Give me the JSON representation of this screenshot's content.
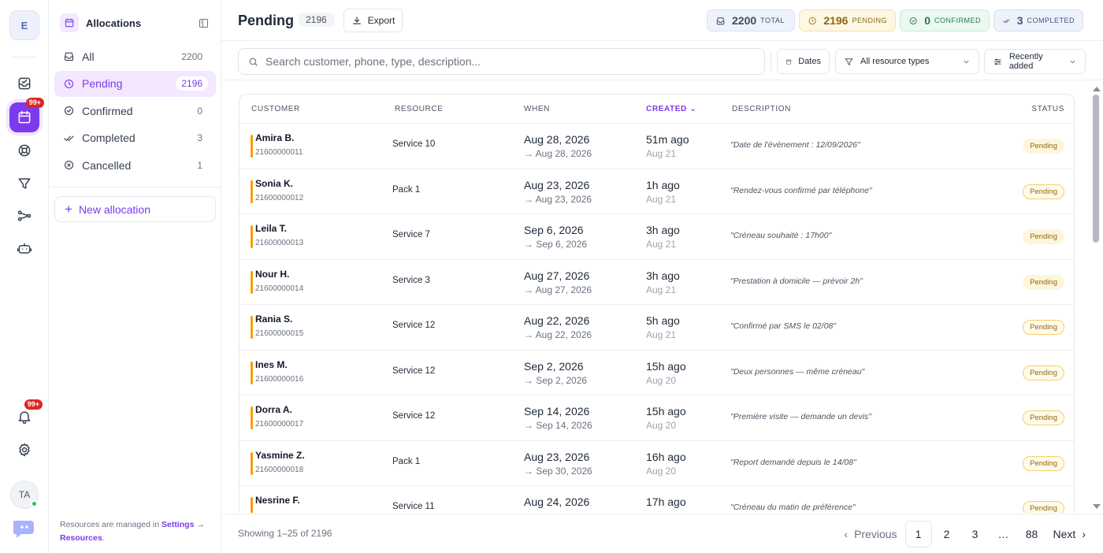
{
  "rail": {
    "workspace_initial": "E",
    "calendar_badge": "99+",
    "notifications_badge": "99+",
    "user_initials": "TA"
  },
  "sidebar": {
    "title": "Allocations",
    "items": [
      {
        "label": "All",
        "count": "2200",
        "icon": "inbox-icon"
      },
      {
        "label": "Pending",
        "count": "2196",
        "icon": "clock-icon"
      },
      {
        "label": "Confirmed",
        "count": "0",
        "icon": "check-circle-icon"
      },
      {
        "label": "Completed",
        "count": "3",
        "icon": "double-check-icon"
      },
      {
        "label": "Cancelled",
        "count": "1",
        "icon": "x-circle-icon"
      }
    ],
    "new_button": "New allocation",
    "footer_text": "Resources are managed in",
    "footer_link": "Settings → Resources",
    "footer_period": "."
  },
  "header": {
    "title": "Pending",
    "count": "2196",
    "export_label": "Export",
    "chips": {
      "total": {
        "value": "2200",
        "unit": "TOTAL"
      },
      "pending": {
        "value": "2196",
        "unit": "PENDING"
      },
      "confirmed": {
        "value": "0",
        "unit": "CONFIRMED"
      },
      "completed": {
        "value": "3",
        "unit": "COMPLETED"
      }
    }
  },
  "filters": {
    "search_placeholder": "Search customer, phone, type, description...",
    "dates_label": "Dates",
    "types_label": "All resource types",
    "sort_label": "Recently added"
  },
  "table": {
    "columns": {
      "customer": "CUSTOMER",
      "resource": "RESOURCE",
      "when": "WHEN",
      "created": "Created",
      "description": "DESCRIPTION",
      "status": "STATUS"
    },
    "rows": [
      {
        "name": "Amira B.",
        "phone": "21600000011",
        "resource": "Service 10",
        "when_start": "Aug 28, 2026",
        "when_end": "→ Aug 28, 2026",
        "created_rel": "51m ago",
        "created_date": "Aug 21",
        "description": "\"Date de l'évènement : 12/09/2026\"",
        "status": "Pending"
      },
      {
        "name": "Sonia K.",
        "phone": "21600000012",
        "resource": "Pack 1",
        "when_start": "Aug 23, 2026",
        "when_end": "→ Aug 23, 2026",
        "created_rel": "1h ago",
        "created_date": "Aug 21",
        "description": "\"Rendez-vous confirmé par téléphone\"",
        "status": "Pending"
      },
      {
        "name": "Leila T.",
        "phone": "21600000013",
        "resource": "Service 7",
        "when_start": "Sep 6, 2026",
        "when_end": "→ Sep 6, 2026",
        "created_rel": "3h ago",
        "created_date": "Aug 21",
        "description": "\"Créneau souhaité : 17h00\"",
        "status": "Pending"
      },
      {
        "name": "Nour H.",
        "phone": "21600000014",
        "resource": "Service 3",
        "when_start": "Aug 27, 2026",
        "when_end": "→ Aug 27, 2026",
        "created_rel": "3h ago",
        "created_date": "Aug 21",
        "description": "\"Prestation à domicile — prévoir 2h\"",
        "status": "Pending"
      },
      {
        "name": "Rania S.",
        "phone": "21600000015",
        "resource": "Service 12",
        "when_start": "Aug 22, 2026",
        "when_end": "→ Aug 22, 2026",
        "created_rel": "5h ago",
        "created_date": "Aug 21",
        "description": "\"Confirmé par SMS le 02/08\"",
        "status": "Pending"
      },
      {
        "name": "Ines M.",
        "phone": "21600000016",
        "resource": "Service 12",
        "when_start": "Sep 2, 2026",
        "when_end": "→ Sep 2, 2026",
        "created_rel": "15h ago",
        "created_date": "Aug 20",
        "description": "\"Deux personnes — même créneau\"",
        "status": "Pending"
      },
      {
        "name": "Dorra A.",
        "phone": "21600000017",
        "resource": "Service 12",
        "when_start": "Sep 14, 2026",
        "when_end": "→ Sep 14, 2026",
        "created_rel": "15h ago",
        "created_date": "Aug 20",
        "description": "\"Première visite — demande un devis\"",
        "status": "Pending"
      },
      {
        "name": "Yasmine Z.",
        "phone": "21600000018",
        "resource": "Pack 1",
        "when_start": "Aug 23, 2026",
        "when_end": "→ Sep 30, 2026",
        "created_rel": "16h ago",
        "created_date": "Aug 20",
        "description": "\"Report demandé depuis le 14/08\"",
        "status": "Pending"
      },
      {
        "name": "Nesrine F.",
        "phone": "",
        "resource": "Service 11",
        "when_start": "Aug 24, 2026",
        "when_end": "",
        "created_rel": "17h ago",
        "created_date": "",
        "description": "\"Créneau du matin de préférence\"",
        "status": "Pending"
      }
    ]
  },
  "footer": {
    "showing": "Showing 1–25 of 2196",
    "previous": "Previous",
    "pages": [
      "1",
      "2",
      "3",
      "…",
      "88"
    ],
    "next": "Next"
  },
  "colors": {
    "accent": "#7c3aed",
    "pending_bar": "#f59e0b",
    "pending_badge_bg": "#fef6dc"
  }
}
